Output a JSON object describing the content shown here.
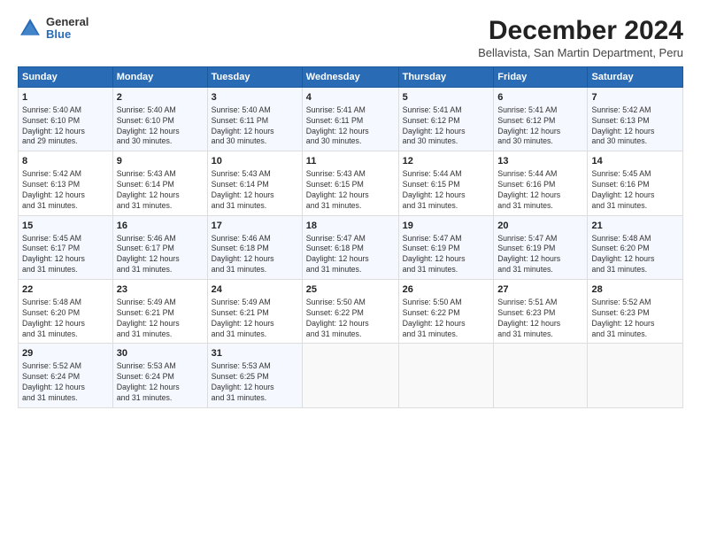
{
  "logo": {
    "line1": "General",
    "line2": "Blue"
  },
  "title": "December 2024",
  "subtitle": "Bellavista, San Martin Department, Peru",
  "header": {
    "days": [
      "Sunday",
      "Monday",
      "Tuesday",
      "Wednesday",
      "Thursday",
      "Friday",
      "Saturday"
    ]
  },
  "weeks": [
    {
      "cells": [
        {
          "day": "1",
          "info": "Sunrise: 5:40 AM\nSunset: 6:10 PM\nDaylight: 12 hours\nand 29 minutes."
        },
        {
          "day": "2",
          "info": "Sunrise: 5:40 AM\nSunset: 6:10 PM\nDaylight: 12 hours\nand 30 minutes."
        },
        {
          "day": "3",
          "info": "Sunrise: 5:40 AM\nSunset: 6:11 PM\nDaylight: 12 hours\nand 30 minutes."
        },
        {
          "day": "4",
          "info": "Sunrise: 5:41 AM\nSunset: 6:11 PM\nDaylight: 12 hours\nand 30 minutes."
        },
        {
          "day": "5",
          "info": "Sunrise: 5:41 AM\nSunset: 6:12 PM\nDaylight: 12 hours\nand 30 minutes."
        },
        {
          "day": "6",
          "info": "Sunrise: 5:41 AM\nSunset: 6:12 PM\nDaylight: 12 hours\nand 30 minutes."
        },
        {
          "day": "7",
          "info": "Sunrise: 5:42 AM\nSunset: 6:13 PM\nDaylight: 12 hours\nand 30 minutes."
        }
      ]
    },
    {
      "cells": [
        {
          "day": "8",
          "info": "Sunrise: 5:42 AM\nSunset: 6:13 PM\nDaylight: 12 hours\nand 31 minutes."
        },
        {
          "day": "9",
          "info": "Sunrise: 5:43 AM\nSunset: 6:14 PM\nDaylight: 12 hours\nand 31 minutes."
        },
        {
          "day": "10",
          "info": "Sunrise: 5:43 AM\nSunset: 6:14 PM\nDaylight: 12 hours\nand 31 minutes."
        },
        {
          "day": "11",
          "info": "Sunrise: 5:43 AM\nSunset: 6:15 PM\nDaylight: 12 hours\nand 31 minutes."
        },
        {
          "day": "12",
          "info": "Sunrise: 5:44 AM\nSunset: 6:15 PM\nDaylight: 12 hours\nand 31 minutes."
        },
        {
          "day": "13",
          "info": "Sunrise: 5:44 AM\nSunset: 6:16 PM\nDaylight: 12 hours\nand 31 minutes."
        },
        {
          "day": "14",
          "info": "Sunrise: 5:45 AM\nSunset: 6:16 PM\nDaylight: 12 hours\nand 31 minutes."
        }
      ]
    },
    {
      "cells": [
        {
          "day": "15",
          "info": "Sunrise: 5:45 AM\nSunset: 6:17 PM\nDaylight: 12 hours\nand 31 minutes."
        },
        {
          "day": "16",
          "info": "Sunrise: 5:46 AM\nSunset: 6:17 PM\nDaylight: 12 hours\nand 31 minutes."
        },
        {
          "day": "17",
          "info": "Sunrise: 5:46 AM\nSunset: 6:18 PM\nDaylight: 12 hours\nand 31 minutes."
        },
        {
          "day": "18",
          "info": "Sunrise: 5:47 AM\nSunset: 6:18 PM\nDaylight: 12 hours\nand 31 minutes."
        },
        {
          "day": "19",
          "info": "Sunrise: 5:47 AM\nSunset: 6:19 PM\nDaylight: 12 hours\nand 31 minutes."
        },
        {
          "day": "20",
          "info": "Sunrise: 5:47 AM\nSunset: 6:19 PM\nDaylight: 12 hours\nand 31 minutes."
        },
        {
          "day": "21",
          "info": "Sunrise: 5:48 AM\nSunset: 6:20 PM\nDaylight: 12 hours\nand 31 minutes."
        }
      ]
    },
    {
      "cells": [
        {
          "day": "22",
          "info": "Sunrise: 5:48 AM\nSunset: 6:20 PM\nDaylight: 12 hours\nand 31 minutes."
        },
        {
          "day": "23",
          "info": "Sunrise: 5:49 AM\nSunset: 6:21 PM\nDaylight: 12 hours\nand 31 minutes."
        },
        {
          "day": "24",
          "info": "Sunrise: 5:49 AM\nSunset: 6:21 PM\nDaylight: 12 hours\nand 31 minutes."
        },
        {
          "day": "25",
          "info": "Sunrise: 5:50 AM\nSunset: 6:22 PM\nDaylight: 12 hours\nand 31 minutes."
        },
        {
          "day": "26",
          "info": "Sunrise: 5:50 AM\nSunset: 6:22 PM\nDaylight: 12 hours\nand 31 minutes."
        },
        {
          "day": "27",
          "info": "Sunrise: 5:51 AM\nSunset: 6:23 PM\nDaylight: 12 hours\nand 31 minutes."
        },
        {
          "day": "28",
          "info": "Sunrise: 5:52 AM\nSunset: 6:23 PM\nDaylight: 12 hours\nand 31 minutes."
        }
      ]
    },
    {
      "cells": [
        {
          "day": "29",
          "info": "Sunrise: 5:52 AM\nSunset: 6:24 PM\nDaylight: 12 hours\nand 31 minutes."
        },
        {
          "day": "30",
          "info": "Sunrise: 5:53 AM\nSunset: 6:24 PM\nDaylight: 12 hours\nand 31 minutes."
        },
        {
          "day": "31",
          "info": "Sunrise: 5:53 AM\nSunset: 6:25 PM\nDaylight: 12 hours\nand 31 minutes."
        },
        {
          "day": "",
          "info": ""
        },
        {
          "day": "",
          "info": ""
        },
        {
          "day": "",
          "info": ""
        },
        {
          "day": "",
          "info": ""
        }
      ]
    }
  ]
}
